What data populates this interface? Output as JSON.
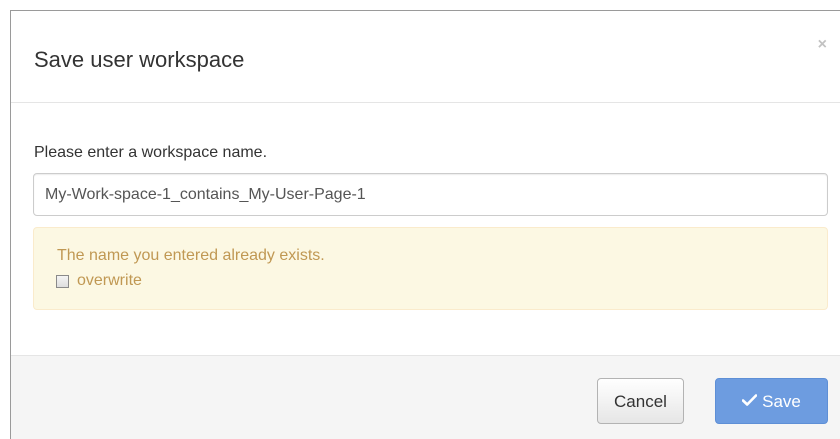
{
  "dialog": {
    "title": "Save user workspace",
    "close_icon": "close-icon"
  },
  "body": {
    "prompt": "Please enter a workspace name.",
    "name_input_value": "My-Work-space-1_contains_My-User-Page-1"
  },
  "alert": {
    "message": "The name you entered already exists.",
    "overwrite_label": "overwrite",
    "overwrite_checked": false,
    "text_color": "#c09853",
    "background_color": "#fcf8e3"
  },
  "footer": {
    "cancel_label": "Cancel",
    "save_label": "Save",
    "save_icon": "check-icon",
    "save_color": "#6d9ce0"
  }
}
